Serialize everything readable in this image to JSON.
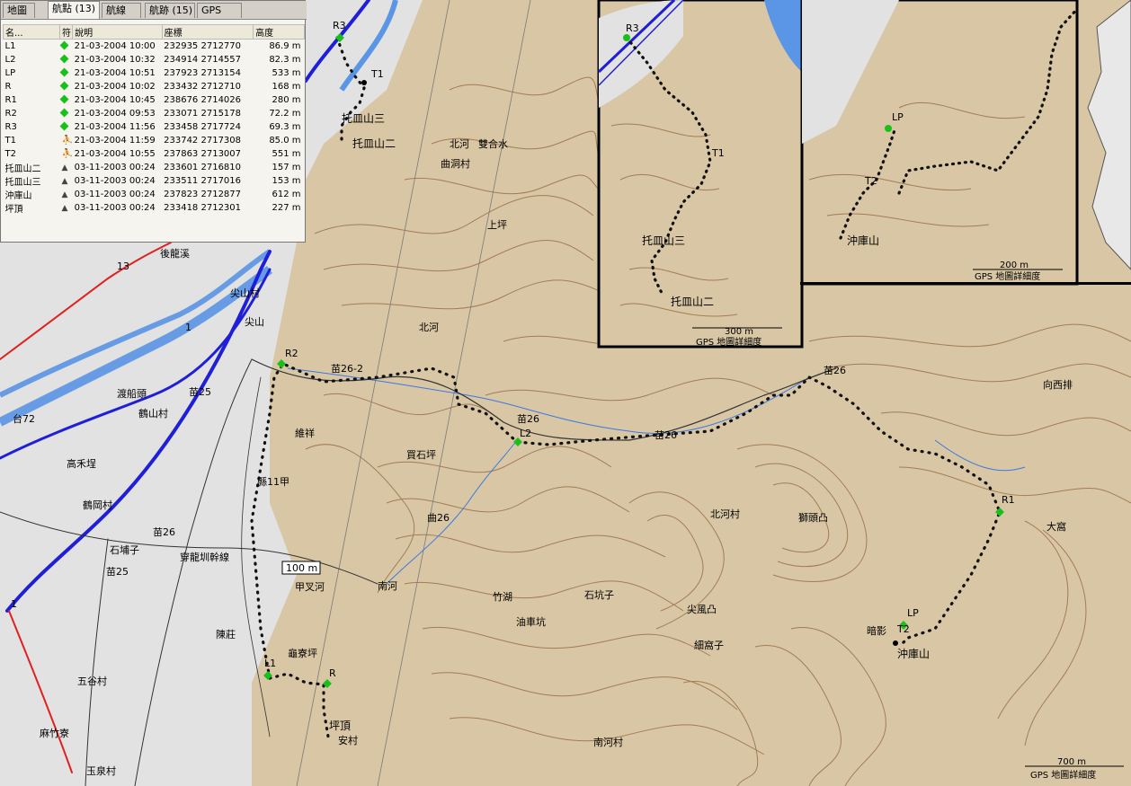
{
  "tabs": [
    "地圖",
    "航點 (13)",
    "航線",
    "航跡 (15)",
    "GPS"
  ],
  "active_tab": 1,
  "table": {
    "headers": [
      "名...",
      "符",
      "說明",
      "座標",
      "高度"
    ],
    "rows": [
      {
        "name": "L1",
        "sym": "flag",
        "desc": "21-03-2004 10:00",
        "coord": "232935 2712770",
        "alt": "86.9 m"
      },
      {
        "name": "L2",
        "sym": "flag",
        "desc": "21-03-2004 10:32",
        "coord": "234914 2714557",
        "alt": "82.3 m"
      },
      {
        "name": "LP",
        "sym": "flag",
        "desc": "21-03-2004 10:51",
        "coord": "237923 2713154",
        "alt": "533 m"
      },
      {
        "name": "R",
        "sym": "flag",
        "desc": "21-03-2004 10:02",
        "coord": "233432 2712710",
        "alt": "168 m"
      },
      {
        "name": "R1",
        "sym": "flag",
        "desc": "21-03-2004 10:45",
        "coord": "238676 2714026",
        "alt": "280 m"
      },
      {
        "name": "R2",
        "sym": "flag",
        "desc": "21-03-2004 09:53",
        "coord": "233071 2715178",
        "alt": "72.2 m"
      },
      {
        "name": "R3",
        "sym": "flag",
        "desc": "21-03-2004 11:56",
        "coord": "233458 2717724",
        "alt": "69.3 m"
      },
      {
        "name": "T1",
        "sym": "hiker",
        "desc": "21-03-2004 11:59",
        "coord": "233742 2717308",
        "alt": "85.0 m"
      },
      {
        "name": "T2",
        "sym": "hiker",
        "desc": "21-03-2004 10:55",
        "coord": "237863 2713007",
        "alt": "551 m"
      },
      {
        "name": "托皿山二",
        "sym": "peak",
        "desc": "03-11-2003 00:24",
        "coord": "233601 2716810",
        "alt": "157 m"
      },
      {
        "name": "托皿山三",
        "sym": "peak",
        "desc": "03-11-2003 00:24",
        "coord": "233511 2717016",
        "alt": "153 m"
      },
      {
        "name": "沖庫山",
        "sym": "peak",
        "desc": "03-11-2003 00:24",
        "coord": "237823 2712877",
        "alt": "612 m"
      },
      {
        "name": "坪頂",
        "sym": "peak",
        "desc": "03-11-2003 00:24",
        "coord": "233418 2712301",
        "alt": "227 m"
      }
    ]
  },
  "colors": {
    "terrain": "#d8c6a4",
    "plain": "#e2e2e2",
    "contour": "#9a7048",
    "river": "#5a95e6",
    "highway": "#1f1fd8",
    "track": "#111111",
    "waypoint": "#19c019"
  },
  "map": {
    "waypoints": [
      {
        "id": "R3",
        "label": "R3"
      },
      {
        "id": "T1",
        "label": "T1"
      },
      {
        "id": "R2",
        "label": "R2"
      },
      {
        "id": "L2",
        "label": "L2"
      },
      {
        "id": "L1",
        "label": "L1"
      },
      {
        "id": "R",
        "label": "R"
      },
      {
        "id": "R1",
        "label": "R1"
      },
      {
        "id": "LP",
        "label": "LP"
      },
      {
        "id": "T2",
        "label": "T2"
      }
    ],
    "peak_labels": {
      "tuomin3": "托皿山三",
      "tuomin2": "托皿山二",
      "chongku": "沖庫山",
      "pingding": "坪頂"
    },
    "places": [
      "後龍溪",
      "尖山村",
      "尖山",
      "北河",
      "鶴山村",
      "渡船頭",
      "高禾埕",
      "鶴岡村",
      "石埔子",
      "穿龍圳幹線",
      "陳莊",
      "龜寮坪",
      "甲叉河",
      "南河",
      "竹湖",
      "油車坑",
      "石坑子",
      "尖風凸",
      "細窩子",
      "獅頭凸",
      "北河村",
      "大窩",
      "向西排",
      "玉泉村",
      "麻竹寮",
      "五谷村",
      "曲洞村",
      "雙合水",
      "上坪",
      "北河",
      "買石坪",
      "維祥",
      "暗影",
      "安村",
      "南河村"
    ],
    "roads": [
      "苗26-2",
      "苗26",
      "苗26",
      "苗26",
      "苗26",
      "13",
      "1",
      "1",
      "台72",
      "苗25",
      "縣11甲",
      "苗25",
      "曲26"
    ],
    "scale_main": "100 m",
    "scale_main_note": "",
    "inset1": {
      "scale": "300 m",
      "footer": "GPS 地圖詳細度"
    },
    "inset2": {
      "scale": "200 m",
      "footer": "GPS 地圖詳細度"
    },
    "corner_scale": {
      "scale": "700 m",
      "footer": "GPS 地圖詳細度"
    }
  }
}
